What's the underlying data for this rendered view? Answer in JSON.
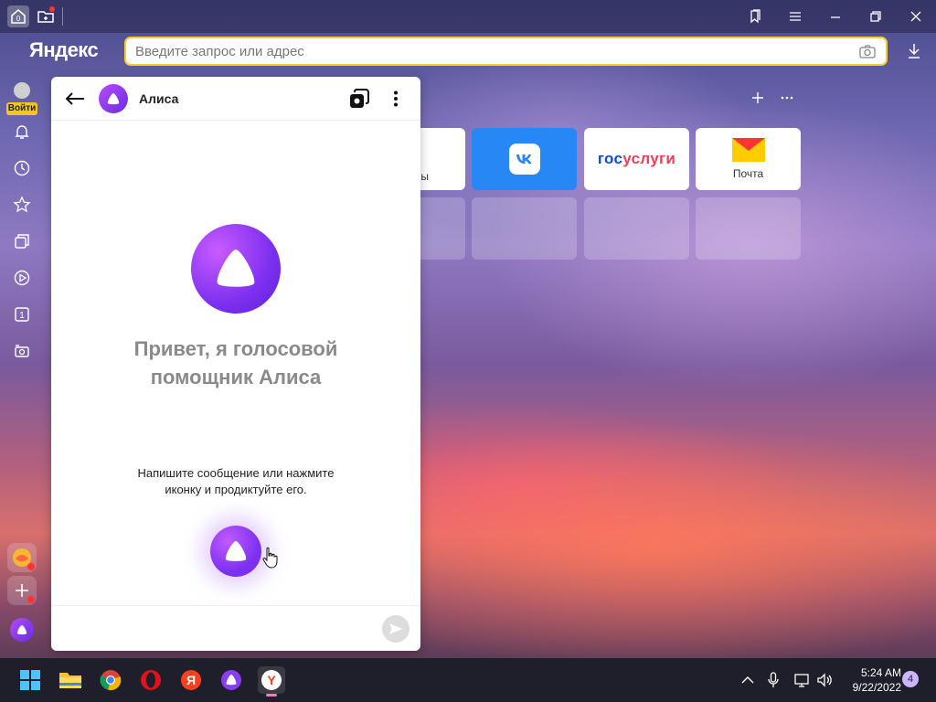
{
  "browser": {
    "brand": "Яндекс",
    "tab_count_badge": "0",
    "address_placeholder": "Введите запрос или адрес",
    "login_label": "Войти",
    "sidebar_badge": "1"
  },
  "speed_dial": {
    "partial_tile_label": "ы",
    "tiles": [
      {
        "label": "",
        "logo": "vk-logo"
      },
      {
        "label": "",
        "logo": "gosuslugi-logo",
        "logo_text": "госуслуги"
      },
      {
        "label": "Почта",
        "logo": "mail-envelope-logo"
      }
    ]
  },
  "alice": {
    "title": "Алиса",
    "greeting": "Привет, я голосовой помощник Алиса",
    "hint": "Напишите сообщение или нажмите иконку и продиктуйте его.",
    "input_placeholder": ""
  },
  "taskbar": {
    "time": "5:24 AM",
    "date": "9/22/2022",
    "notifications": "4"
  },
  "colors": {
    "address_border": "#f9cb2a",
    "alice_purple": "#7d30f0",
    "vk_blue": "#2787f5"
  }
}
